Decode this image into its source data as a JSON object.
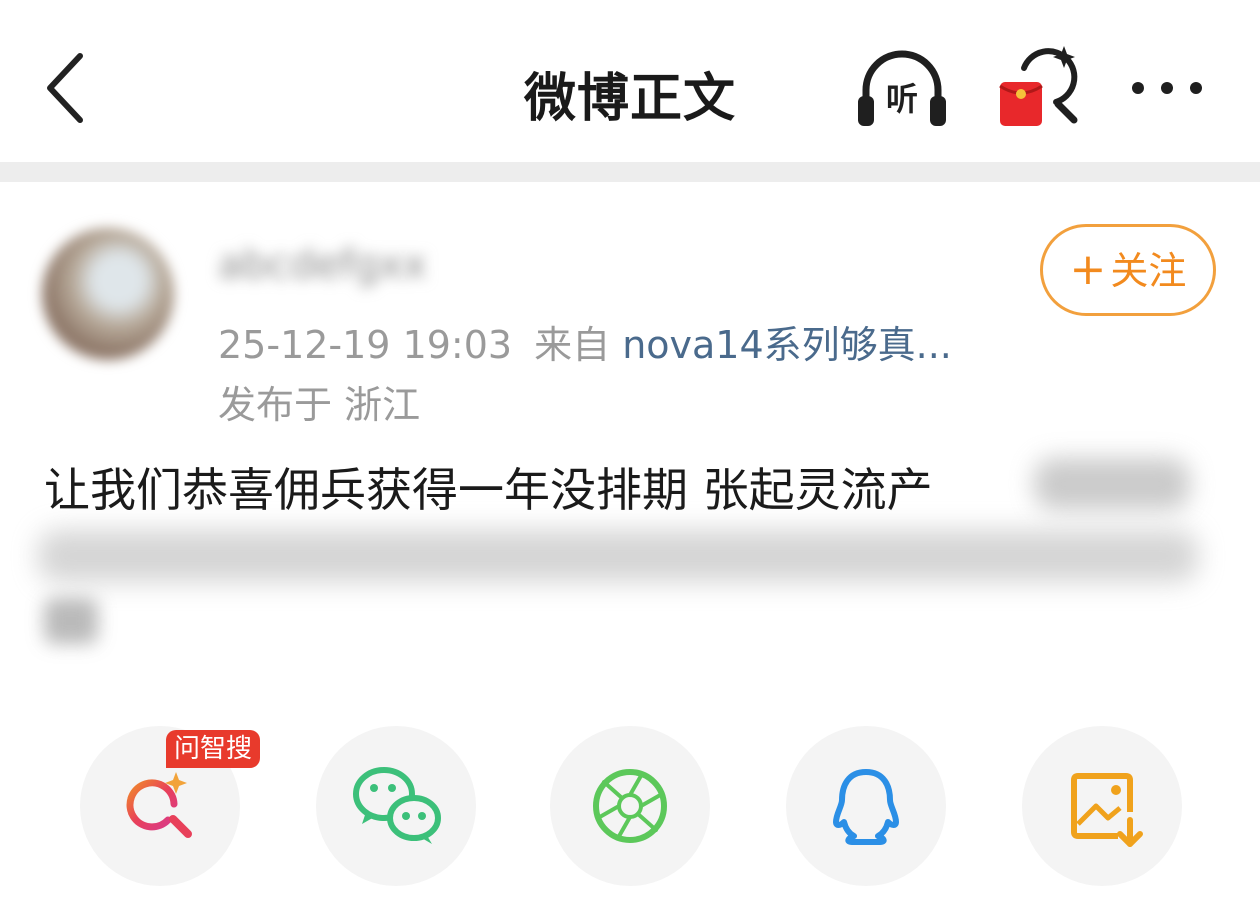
{
  "header": {
    "title": "微博正文",
    "listen_label": "听",
    "back_icon": "chevron-left-icon",
    "more_icon": "ellipsis-icon"
  },
  "post": {
    "username": "abcdefgxx",
    "follow_label": "关注",
    "follow_plus": "+",
    "timestamp": "25-12-19 19:03",
    "source_prefix": "来自",
    "source_app": "nova14系列够真...",
    "location": "发布于 浙江",
    "text": "让我们恭喜佣兵获得一年没排期 张起灵流产"
  },
  "share": {
    "badge": "问智搜",
    "items": [
      "ai-search",
      "wechat",
      "moments",
      "qq",
      "save-image"
    ]
  },
  "colors": {
    "accent_orange": "#f28a1e",
    "wechat_green": "#3cc07a",
    "moments_green": "#5cc85a",
    "qq_blue": "#2b8fe6",
    "save_orange": "#f0a21c",
    "badge_red": "#e83a2c",
    "link_blue": "#4a6a8c"
  }
}
